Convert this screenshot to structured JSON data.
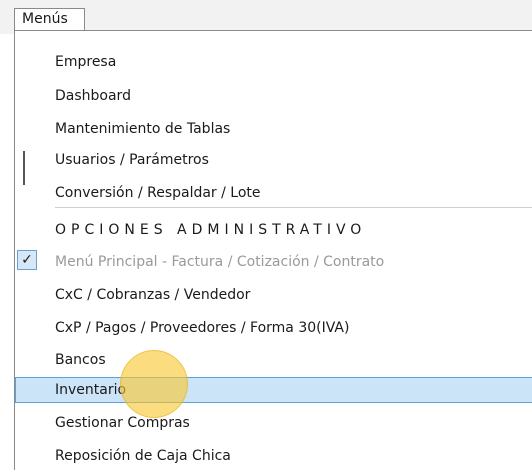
{
  "menubar": {
    "title": "Menús"
  },
  "menu": {
    "items": [
      {
        "name": "menu-item-empresa",
        "label": "Empresa"
      },
      {
        "name": "menu-item-dashboard",
        "label": "Dashboard"
      },
      {
        "name": "menu-item-mantenimiento",
        "label": "Mantenimiento de Tablas"
      },
      {
        "name": "menu-item-usuarios",
        "label": "Usuarios / Parámetros"
      },
      {
        "name": "menu-item-conversion",
        "label": "Conversión / Respaldar / Lote"
      },
      {
        "name": "menu-header-administrativo",
        "label": "OPCIONES ADMINISTRATIVO"
      },
      {
        "name": "menu-item-menu-principal",
        "label": "Menú Principal - Factura / Cotización / Contrato",
        "checked": true,
        "disabled": true
      },
      {
        "name": "menu-item-cxc",
        "label": "CxC / Cobranzas / Vendedor"
      },
      {
        "name": "menu-item-cxp",
        "label": "CxP / Pagos / Proveedores / Forma 30(IVA)"
      },
      {
        "name": "menu-item-bancos",
        "label": "Bancos"
      },
      {
        "name": "menu-item-inventario",
        "label": "Inventario",
        "selected": true
      },
      {
        "name": "menu-item-gestionar-compras",
        "label": "Gestionar Compras"
      },
      {
        "name": "menu-item-reposicion",
        "label": "Reposición de Caja Chica"
      }
    ]
  },
  "icons": {
    "check": "check-icon"
  },
  "colors": {
    "highlight": "#cce4f7",
    "highlight_border": "#5ea1d6",
    "disabled": "#9a9a9a",
    "cursor": "#f8c630"
  }
}
